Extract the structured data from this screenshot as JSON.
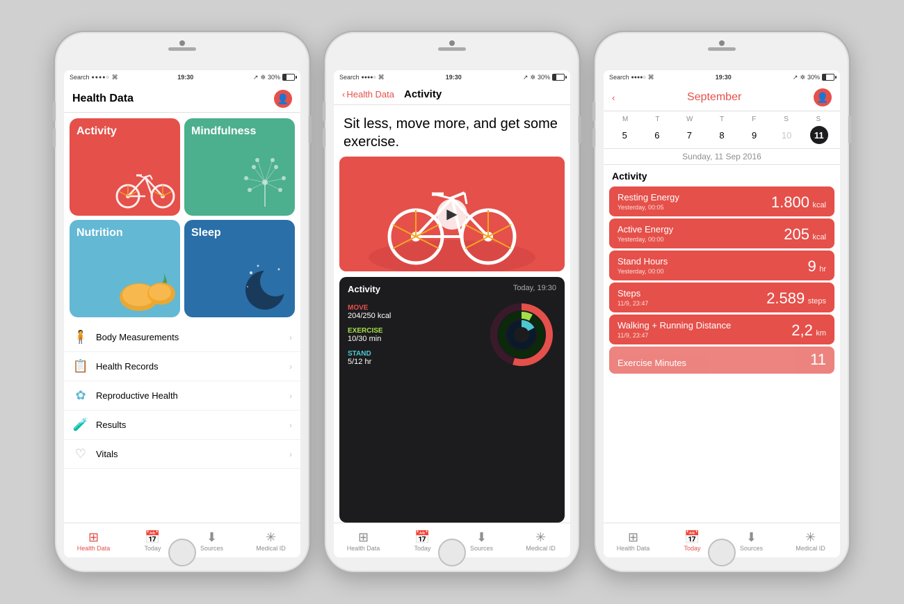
{
  "colors": {
    "red": "#e5504a",
    "green": "#4caf8e",
    "blue": "#63b8d4",
    "darkblue": "#2a6fa8",
    "dark": "#1c1c1e",
    "gray": "#8e8e93"
  },
  "status": {
    "left": "Search",
    "dots": "●●●●○",
    "wifi": "wifi",
    "time": "19:30",
    "location": "↗",
    "bluetooth": "⁂",
    "battery": "30%"
  },
  "phone1": {
    "title": "Health Data",
    "tiles": [
      {
        "label": "Activity",
        "class": "tile-activity"
      },
      {
        "label": "Mindfulness",
        "class": "tile-mindfulness"
      },
      {
        "label": "Nutrition",
        "class": "tile-nutrition"
      },
      {
        "label": "Sleep",
        "class": "tile-sleep"
      }
    ],
    "menu": [
      {
        "icon": "🧍",
        "label": "Body Measurements"
      },
      {
        "icon": "📋",
        "label": "Health Records"
      },
      {
        "icon": "❋",
        "label": "Reproductive Health"
      },
      {
        "icon": "🧪",
        "label": "Results"
      },
      {
        "icon": "🫀",
        "label": "Vitals"
      }
    ],
    "navbar": [
      {
        "label": "Health Data",
        "active": true
      },
      {
        "label": "Today"
      },
      {
        "label": "Sources"
      },
      {
        "label": "Medical ID"
      }
    ]
  },
  "phone2": {
    "back": "Health Data",
    "title": "Activity",
    "description": "Sit less, move more, and get some exercise.",
    "card": {
      "title": "Activity",
      "time": "Today, 19:30",
      "stats": [
        {
          "label": "MOVE",
          "value": "204/250 kcal",
          "color": "move"
        },
        {
          "label": "EXERCISE",
          "value": "10/30 min",
          "color": "exercise"
        },
        {
          "label": "STAND",
          "value": "5/12 hr",
          "color": "stand"
        }
      ]
    },
    "navbar": [
      {
        "label": "Health Data"
      },
      {
        "label": "Today"
      },
      {
        "label": "Sources"
      },
      {
        "label": "Medical ID"
      }
    ]
  },
  "phone3": {
    "month": "September",
    "days_header": [
      "M",
      "T",
      "W",
      "T",
      "F",
      "S",
      "S"
    ],
    "days": [
      {
        "n": "5"
      },
      {
        "n": "6"
      },
      {
        "n": "7"
      },
      {
        "n": "8"
      },
      {
        "n": "9"
      },
      {
        "n": "10",
        "faded": true
      },
      {
        "n": "11",
        "today": true
      }
    ],
    "date_label": "Sunday, 11 Sep 2016",
    "section": "Activity",
    "stats": [
      {
        "name": "Resting Energy",
        "big": "1.800",
        "unit": "kcal",
        "sub": "Yesterday, 00:05"
      },
      {
        "name": "Active Energy",
        "big": "205",
        "unit": "kcal",
        "sub": "Yesterday, 00:00"
      },
      {
        "name": "Stand Hours",
        "big": "9",
        "unit": "hr",
        "sub": "Yesterday, 00:00"
      },
      {
        "name": "Steps",
        "big": "2.589",
        "unit": "steps",
        "sub": "11/9, 23:47"
      },
      {
        "name": "Walking + Running Distance",
        "big": "2,2",
        "unit": "km",
        "sub": "11/9, 23:47"
      },
      {
        "name": "Exercise Minutes",
        "big": "11",
        "unit": "",
        "sub": ""
      }
    ],
    "navbar": [
      {
        "label": "Health Data"
      },
      {
        "label": "Today",
        "active": true
      },
      {
        "label": "Sources"
      },
      {
        "label": "Medical ID"
      }
    ]
  }
}
